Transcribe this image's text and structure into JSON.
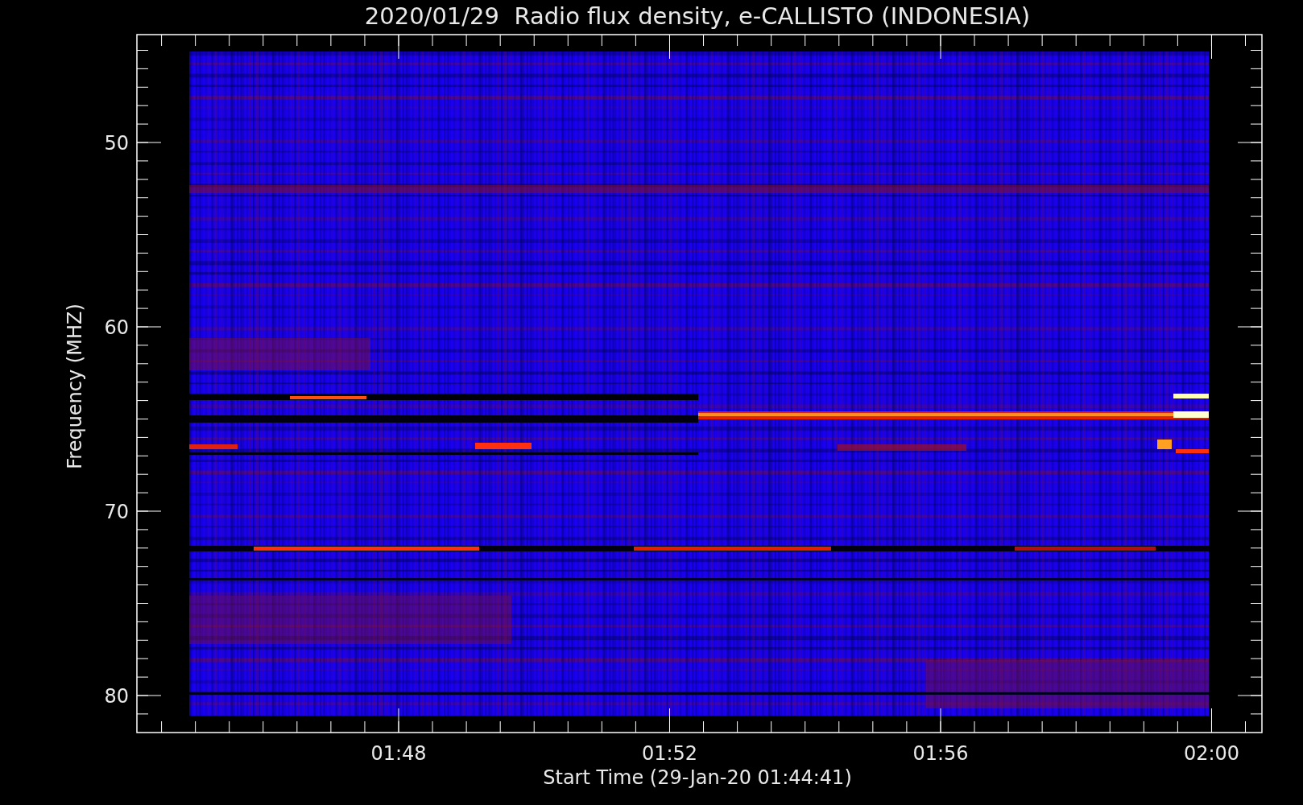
{
  "title": "2020/01/29  Radio flux density, e-CALLISTO (INDONESIA)",
  "y_axis": {
    "label": "Frequency (MHZ)",
    "ticks": [
      "50",
      "60",
      "70",
      "80"
    ]
  },
  "x_axis": {
    "label": "Start Time (29-Jan-20 01:44:41)",
    "ticks": [
      "01:48",
      "01:52",
      "01:56",
      "02:00"
    ]
  }
}
